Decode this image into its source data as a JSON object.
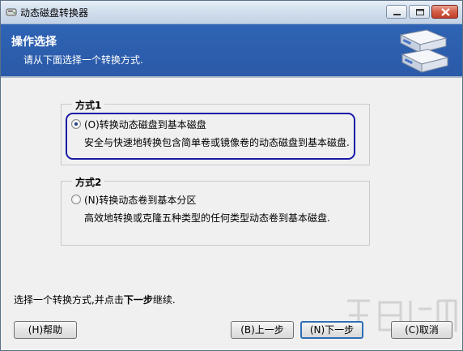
{
  "window": {
    "title": "动态磁盘转换器",
    "controls": [
      "minimize-icon",
      "maximize-icon",
      "close-icon"
    ]
  },
  "header": {
    "title": "操作选择",
    "subtitle": "请从下面选择一个转换方式."
  },
  "options": [
    {
      "group_label": "方式1",
      "label": "(O)转换动态磁盘到基本磁盘",
      "description": "安全与快速地转换包含简单卷或镜像卷的动态磁盘到基本磁盘.",
      "selected": true
    },
    {
      "group_label": "方式2",
      "label": "(N)转换动态卷到基本分区",
      "description": "高效地转换或克隆五种类型的任何类型动态卷到基本磁盘.",
      "selected": false
    }
  ],
  "status": {
    "prefix": "选择一个转换方式,并点击",
    "bold": "下一步",
    "suffix": "继续."
  },
  "buttons": {
    "help": "(H)帮助",
    "back": "(B)上一步",
    "next": "(N)下一步",
    "cancel": "(C)取消"
  },
  "colors": {
    "header_bg": "#2f63b4",
    "highlight_border": "#1a1aa6",
    "default_button_border": "#2d6fb5"
  }
}
